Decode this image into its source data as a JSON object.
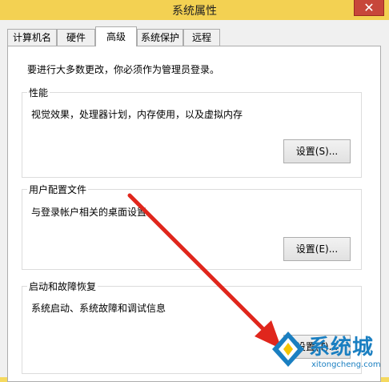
{
  "window": {
    "title": "系统属性",
    "close_label": "✕"
  },
  "tabs": [
    {
      "label": "计算机名",
      "active": false
    },
    {
      "label": "硬件",
      "active": false
    },
    {
      "label": "高级",
      "active": true
    },
    {
      "label": "系统保护",
      "active": false
    },
    {
      "label": "远程",
      "active": false
    }
  ],
  "admin_notice": "要进行大多数更改，你必须作为管理员登录。",
  "performance": {
    "title": "性能",
    "description": "视觉效果，处理器计划，内存使用，以及虚拟内存",
    "button": "设置(S)..."
  },
  "user_profiles": {
    "title": "用户配置文件",
    "description": "与登录帐户相关的桌面设置",
    "button": "设置(E)..."
  },
  "startup_recovery": {
    "title": "启动和故障恢复",
    "description": "系统启动、系统故障和调试信息",
    "button": "设置(T)..."
  },
  "watermark": {
    "text": "系统城",
    "url": "xitongcheng.com"
  },
  "colors": {
    "titlebar": "#f3d152",
    "close": "#c7473a",
    "arrow": "#e0261c",
    "watermark": "#1a7fc1"
  }
}
